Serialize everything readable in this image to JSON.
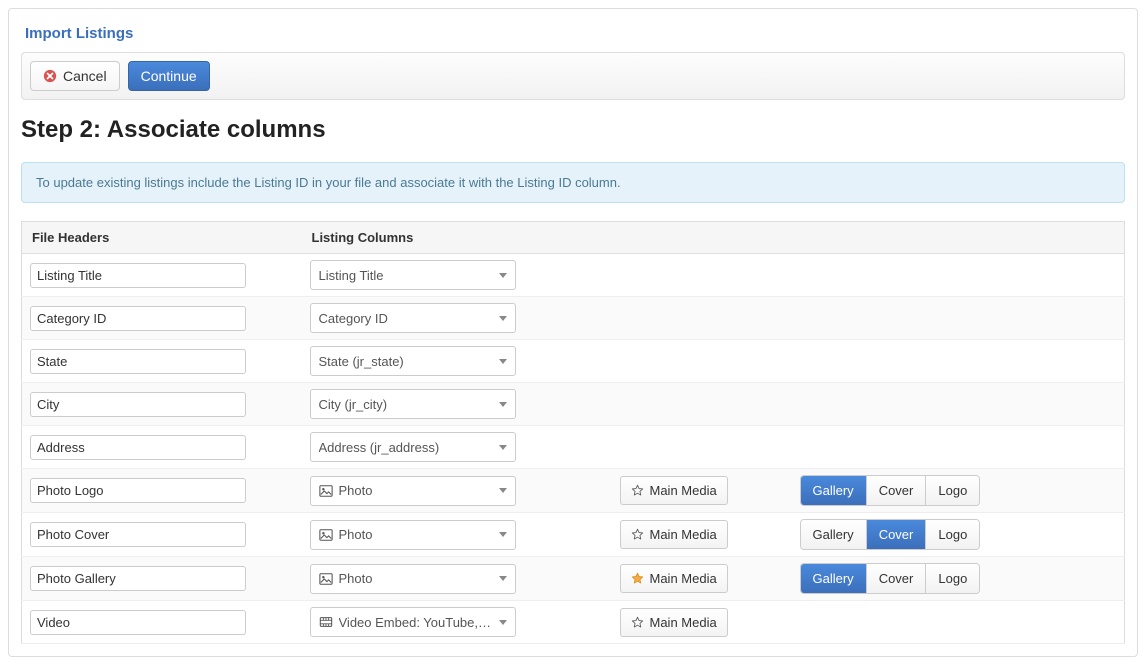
{
  "page": {
    "title": "Import Listings",
    "cancel": "Cancel",
    "continue": "Continue"
  },
  "step_heading": "Step 2: Associate columns",
  "info_text": "To update existing listings include the Listing ID in your file and associate it with the Listing ID column.",
  "columns": {
    "file_headers": "File Headers",
    "listing_columns": "Listing Columns"
  },
  "media_labels": {
    "main_media": "Main Media",
    "gallery": "Gallery",
    "cover": "Cover",
    "logo": "Logo"
  },
  "rows": [
    {
      "header": "Listing Title",
      "column": "Listing Title",
      "icon": null
    },
    {
      "header": "Category ID",
      "column": "Category ID",
      "icon": null
    },
    {
      "header": "State",
      "column": "State (jr_state)",
      "icon": null
    },
    {
      "header": "City",
      "column": "City (jr_city)",
      "icon": null
    },
    {
      "header": "Address",
      "column": "Address (jr_address)",
      "icon": null
    },
    {
      "header": "Photo Logo",
      "column": "Photo",
      "icon": "image",
      "media": {
        "main": false,
        "type": "gallery"
      }
    },
    {
      "header": "Photo Cover",
      "column": "Photo",
      "icon": "image",
      "media": {
        "main": false,
        "type": "cover"
      }
    },
    {
      "header": "Photo Gallery",
      "column": "Photo",
      "icon": "image",
      "media": {
        "main": true,
        "type": "gallery"
      }
    },
    {
      "header": "Video",
      "column": "Video Embed: YouTube, …",
      "icon": "video",
      "media": {
        "main": false,
        "type": null
      }
    }
  ]
}
